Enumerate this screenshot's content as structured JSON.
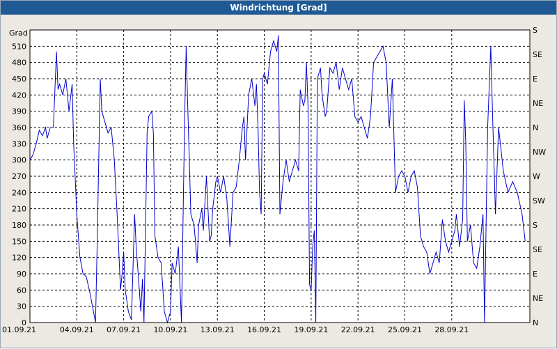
{
  "window": {
    "title": "Windrichtung [Grad]"
  },
  "chart_data": {
    "type": "line",
    "title": "Windrichtung [Grad]",
    "ylabel": "Grad",
    "ylim": [
      0,
      540
    ],
    "y_ticks": [
      0,
      30,
      60,
      90,
      120,
      150,
      180,
      210,
      240,
      270,
      300,
      330,
      360,
      390,
      420,
      450,
      480,
      510
    ],
    "x_tick_labels": [
      "01.09.21",
      "04.09.21",
      "07.09.21",
      "10.09.21",
      "13.09.21",
      "16.09.21",
      "19.09.21",
      "22.09.21",
      "25.09.21",
      "28.09.21"
    ],
    "x_range_days": [
      0,
      30
    ],
    "right_axis_labels": [
      {
        "v": 0,
        "label": "N"
      },
      {
        "v": 45,
        "label": "NE"
      },
      {
        "v": 90,
        "label": "E"
      },
      {
        "v": 135,
        "label": "SE"
      },
      {
        "v": 180,
        "label": "S"
      },
      {
        "v": 225,
        "label": "SW"
      },
      {
        "v": 270,
        "label": "W"
      },
      {
        "v": 315,
        "label": "NW"
      },
      {
        "v": 360,
        "label": "N"
      },
      {
        "v": 405,
        "label": "NE"
      },
      {
        "v": 450,
        "label": "E"
      },
      {
        "v": 495,
        "label": "SE"
      },
      {
        "v": 540,
        "label": "S"
      }
    ],
    "grid": true,
    "line_color": "#0000cc",
    "series": [
      {
        "values": [
          [
            0.0,
            300
          ],
          [
            0.2,
            310
          ],
          [
            0.4,
            330
          ],
          [
            0.6,
            355
          ],
          [
            0.8,
            345
          ],
          [
            1.0,
            360
          ],
          [
            1.1,
            340
          ],
          [
            1.3,
            360
          ],
          [
            1.5,
            360
          ],
          [
            1.7,
            500
          ],
          [
            1.8,
            430
          ],
          [
            1.9,
            440
          ],
          [
            2.1,
            420
          ],
          [
            2.3,
            450
          ],
          [
            2.5,
            390
          ],
          [
            2.7,
            440
          ],
          [
            2.8,
            330
          ],
          [
            3.0,
            200
          ],
          [
            3.2,
            120
          ],
          [
            3.4,
            90
          ],
          [
            3.6,
            85
          ],
          [
            3.8,
            60
          ],
          [
            4.0,
            30
          ],
          [
            4.2,
            0
          ],
          [
            4.3,
            140
          ],
          [
            4.5,
            450
          ],
          [
            4.6,
            390
          ],
          [
            4.8,
            370
          ],
          [
            5.0,
            350
          ],
          [
            5.2,
            360
          ],
          [
            5.4,
            300
          ],
          [
            5.6,
            190
          ],
          [
            5.8,
            60
          ],
          [
            5.9,
            90
          ],
          [
            6.0,
            130
          ],
          [
            6.1,
            60
          ],
          [
            6.3,
            20
          ],
          [
            6.5,
            5
          ],
          [
            6.7,
            200
          ],
          [
            6.8,
            140
          ],
          [
            7.0,
            60
          ],
          [
            7.1,
            20
          ],
          [
            7.2,
            80
          ],
          [
            7.3,
            0
          ],
          [
            7.5,
            350
          ],
          [
            7.6,
            380
          ],
          [
            7.8,
            390
          ],
          [
            7.9,
            350
          ],
          [
            8.0,
            160
          ],
          [
            8.2,
            120
          ],
          [
            8.4,
            110
          ],
          [
            8.6,
            20
          ],
          [
            8.8,
            0
          ],
          [
            9.0,
            20
          ],
          [
            9.1,
            110
          ],
          [
            9.3,
            90
          ],
          [
            9.5,
            140
          ],
          [
            9.7,
            0
          ],
          [
            9.9,
            370
          ],
          [
            10.0,
            510
          ],
          [
            10.1,
            400
          ],
          [
            10.2,
            300
          ],
          [
            10.3,
            200
          ],
          [
            10.5,
            180
          ],
          [
            10.6,
            150
          ],
          [
            10.7,
            110
          ],
          [
            10.8,
            180
          ],
          [
            11.0,
            210
          ],
          [
            11.1,
            170
          ],
          [
            11.3,
            270
          ],
          [
            11.5,
            150
          ],
          [
            11.6,
            160
          ],
          [
            11.7,
            210
          ],
          [
            11.9,
            260
          ],
          [
            12.0,
            270
          ],
          [
            12.2,
            240
          ],
          [
            12.4,
            270
          ],
          [
            12.6,
            230
          ],
          [
            12.8,
            140
          ],
          [
            13.0,
            240
          ],
          [
            13.2,
            250
          ],
          [
            13.4,
            300
          ],
          [
            13.6,
            360
          ],
          [
            13.7,
            380
          ],
          [
            13.8,
            300
          ],
          [
            14.0,
            420
          ],
          [
            14.2,
            450
          ],
          [
            14.4,
            400
          ],
          [
            14.5,
            440
          ],
          [
            14.6,
            360
          ],
          [
            14.7,
            240
          ],
          [
            14.8,
            200
          ],
          [
            14.9,
            450
          ],
          [
            15.0,
            460
          ],
          [
            15.2,
            440
          ],
          [
            15.4,
            500
          ],
          [
            15.6,
            520
          ],
          [
            15.8,
            500
          ],
          [
            15.9,
            530
          ],
          [
            16.0,
            200
          ],
          [
            16.2,
            260
          ],
          [
            16.4,
            300
          ],
          [
            16.6,
            260
          ],
          [
            16.8,
            280
          ],
          [
            17.0,
            300
          ],
          [
            17.2,
            280
          ],
          [
            17.3,
            430
          ],
          [
            17.5,
            400
          ],
          [
            17.6,
            410
          ],
          [
            17.7,
            480
          ],
          [
            17.8,
            400
          ],
          [
            17.9,
            70
          ],
          [
            18.0,
            60
          ],
          [
            18.1,
            140
          ],
          [
            18.2,
            170
          ],
          [
            18.3,
            0
          ],
          [
            18.4,
            450
          ],
          [
            18.6,
            470
          ],
          [
            18.7,
            420
          ],
          [
            18.9,
            380
          ],
          [
            19.0,
            390
          ],
          [
            19.2,
            470
          ],
          [
            19.4,
            460
          ],
          [
            19.6,
            480
          ],
          [
            19.8,
            430
          ],
          [
            20.0,
            470
          ],
          [
            20.2,
            450
          ],
          [
            20.4,
            430
          ],
          [
            20.6,
            450
          ],
          [
            20.8,
            380
          ],
          [
            21.0,
            370
          ],
          [
            21.2,
            380
          ],
          [
            21.4,
            360
          ],
          [
            21.6,
            340
          ],
          [
            21.8,
            380
          ],
          [
            22.0,
            480
          ],
          [
            22.2,
            490
          ],
          [
            22.4,
            500
          ],
          [
            22.6,
            510
          ],
          [
            22.8,
            480
          ],
          [
            23.0,
            360
          ],
          [
            23.2,
            450
          ],
          [
            23.4,
            240
          ],
          [
            23.6,
            270
          ],
          [
            23.8,
            280
          ],
          [
            24.0,
            270
          ],
          [
            24.2,
            240
          ],
          [
            24.4,
            270
          ],
          [
            24.6,
            280
          ],
          [
            24.8,
            250
          ],
          [
            25.0,
            160
          ],
          [
            25.2,
            140
          ],
          [
            25.4,
            130
          ],
          [
            25.6,
            90
          ],
          [
            25.8,
            110
          ],
          [
            26.0,
            130
          ],
          [
            26.2,
            110
          ],
          [
            26.4,
            190
          ],
          [
            26.6,
            150
          ],
          [
            26.8,
            130
          ],
          [
            27.0,
            150
          ],
          [
            27.2,
            170
          ],
          [
            27.3,
            200
          ],
          [
            27.5,
            140
          ],
          [
            27.7,
            190
          ],
          [
            27.8,
            410
          ],
          [
            27.9,
            330
          ],
          [
            28.0,
            150
          ],
          [
            28.2,
            180
          ],
          [
            28.4,
            110
          ],
          [
            28.6,
            100
          ],
          [
            28.8,
            140
          ],
          [
            29.0,
            200
          ],
          [
            29.1,
            0
          ],
          [
            29.3,
            360
          ],
          [
            29.5,
            510
          ],
          [
            29.6,
            400
          ],
          [
            29.8,
            200
          ],
          [
            30.0,
            360
          ],
          [
            30.3,
            280
          ],
          [
            30.6,
            240
          ],
          [
            30.9,
            260
          ],
          [
            31.2,
            240
          ],
          [
            31.5,
            200
          ],
          [
            31.7,
            150
          ]
        ]
      }
    ]
  }
}
